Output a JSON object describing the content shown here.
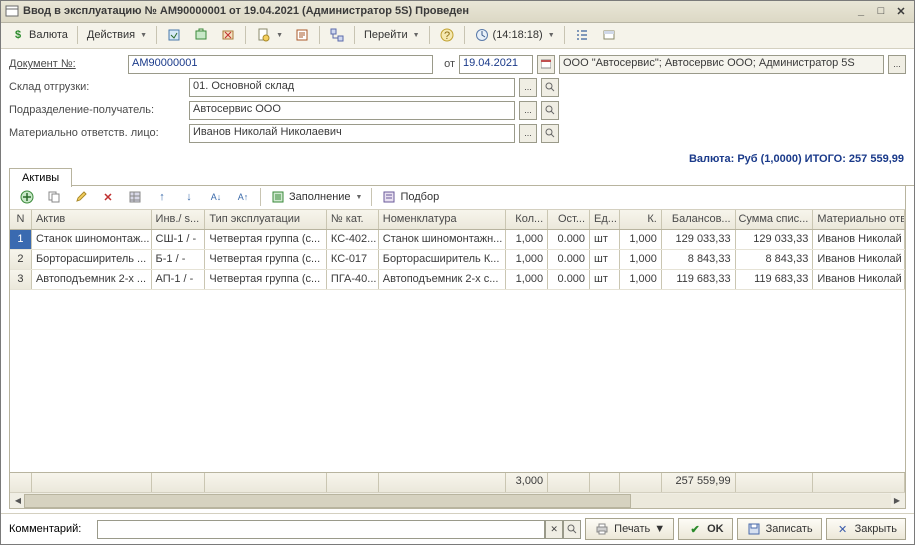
{
  "window": {
    "title": "Ввод в эксплуатацию № АМ90000001 от 19.04.2021 (Администратор 5S) Проведен"
  },
  "toolbar": {
    "currency": "Валюта",
    "actions": "Действия",
    "go": "Перейти",
    "time": "(14:18:18)"
  },
  "form": {
    "doc_label": "Документ №:",
    "doc_value": "АМ90000001",
    "from_label": "от",
    "date": "19.04.2021",
    "company": "ООО \"Автосервис\"; Автосервис ООО; Администратор 5S",
    "warehouse_label": "Склад отгрузки:",
    "warehouse": "01.  Основной склад",
    "division_label": "Подразделение-получатель:",
    "division": "Автосервис ООО",
    "responsible_label": "Материально ответств. лицо:",
    "responsible": "Иванов Николай Николаевич"
  },
  "summary": "Валюта: Руб (1,0000) ИТОГО: 257 559,99",
  "tabs": {
    "assets": "Активы"
  },
  "grid_toolbar": {
    "fill": "Заполнение",
    "select": "Подбор"
  },
  "grid": {
    "headers": {
      "n": "N",
      "asset": "Актив",
      "inv": "Инв./ s...",
      "type": "Тип эксплуатации",
      "cat": "№ кат.",
      "nom": "Номенклатура",
      "qty": "Кол...",
      "ost": "Ост...",
      "ed": "Ед...",
      "k": "К.",
      "bal": "Балансов...",
      "sum": "Сумма спис...",
      "resp": "Материально отв..."
    },
    "rows": [
      {
        "n": "1",
        "asset": "Станок шиномонтаж...",
        "inv": "СШ-1 / -",
        "type": "Четвертая группа (с...",
        "cat": "КС-402...",
        "nom": "Станок шиномонтажн...",
        "qty": "1,000",
        "ost": "0.000",
        "ed": "шт",
        "k": "1,000",
        "bal": "129 033,33",
        "sum": "129 033,33",
        "resp": "Иванов Николай ..."
      },
      {
        "n": "2",
        "asset": "Борторасширитель ...",
        "inv": "Б-1 / -",
        "type": "Четвертая группа (с...",
        "cat": "КС-017",
        "nom": "Борторасширитель К...",
        "qty": "1,000",
        "ost": "0.000",
        "ed": "шт",
        "k": "1,000",
        "bal": "8 843,33",
        "sum": "8 843,33",
        "resp": "Иванов Николай ..."
      },
      {
        "n": "3",
        "asset": "Автоподъемник 2-х ...",
        "inv": "АП-1 / -",
        "type": "Четвертая группа (с...",
        "cat": "ПГА-40...",
        "nom": "Автоподъемник 2-х с...",
        "qty": "1,000",
        "ost": "0.000",
        "ed": "шт",
        "k": "1,000",
        "bal": "119 683,33",
        "sum": "119 683,33",
        "resp": "Иванов Николай ..."
      }
    ],
    "footer": {
      "qty": "3,000",
      "bal": "257 559,99"
    }
  },
  "bottom": {
    "comment_label": "Комментарий:",
    "print": "Печать",
    "ok": "OK",
    "save": "Записать",
    "close": "Закрыть"
  }
}
